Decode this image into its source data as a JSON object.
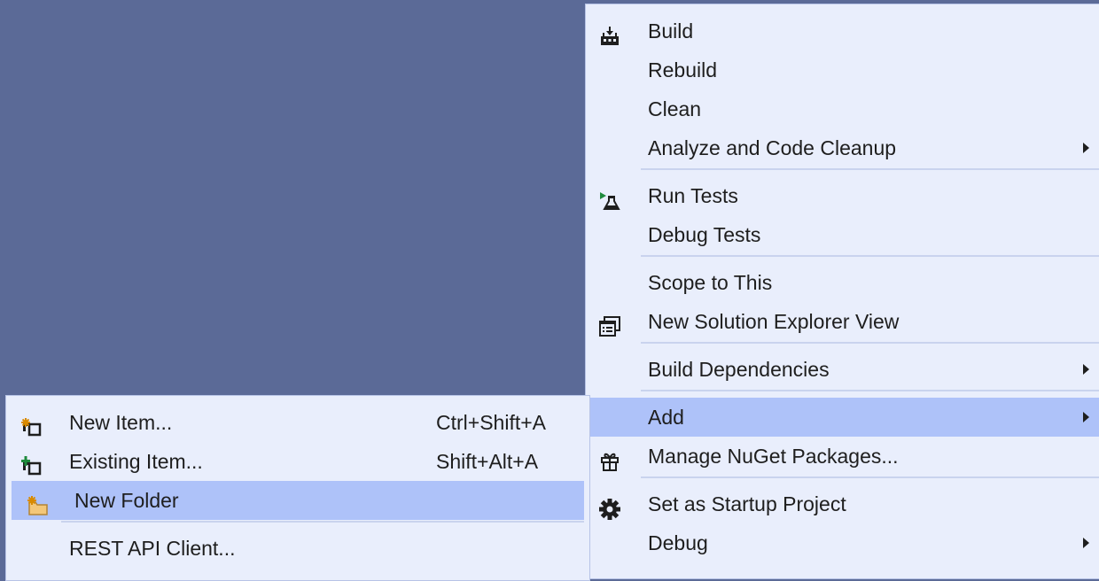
{
  "main_menu": {
    "build": "Build",
    "rebuild": "Rebuild",
    "clean": "Clean",
    "analyze": "Analyze and Code Cleanup",
    "run_tests": "Run Tests",
    "debug_tests": "Debug Tests",
    "scope": "Scope to This",
    "new_view": "New Solution Explorer View",
    "build_deps": "Build Dependencies",
    "add": "Add",
    "nuget": "Manage NuGet Packages...",
    "startup": "Set as Startup Project",
    "debug": "Debug"
  },
  "add_submenu": {
    "new_item": "New Item...",
    "new_item_shortcut": "Ctrl+Shift+A",
    "existing_item": "Existing Item...",
    "existing_item_shortcut": "Shift+Alt+A",
    "new_folder": "New Folder",
    "rest_api": "REST API Client..."
  },
  "icons": {
    "build": "build-icon",
    "run_tests": "run-tests-icon",
    "new_view": "new-solution-explorer-view-icon",
    "nuget": "nuget-package-icon",
    "startup": "gear-icon",
    "new_item": "new-item-icon",
    "existing_item": "existing-item-icon",
    "new_folder": "new-folder-icon"
  },
  "colors": {
    "background": "#5b6a97",
    "menu": "#e9eefc",
    "highlight": "#aec2f9",
    "accent_orange": "#d98a00",
    "accent_green": "#1e8a3c"
  }
}
